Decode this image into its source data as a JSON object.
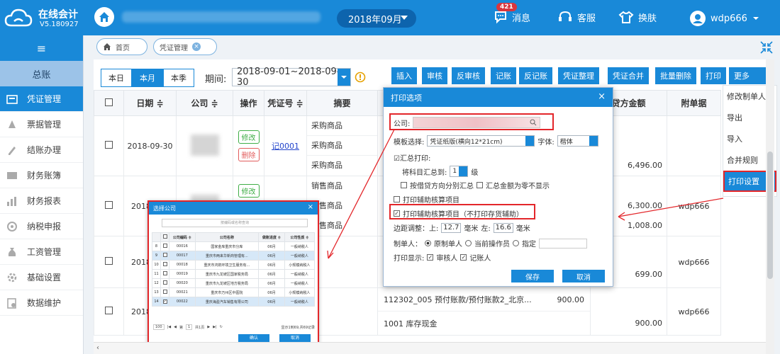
{
  "app": {
    "title": "在线会计",
    "version": "V5.180927",
    "period": "2018年09月",
    "messages": {
      "label": "消息",
      "count": "421"
    },
    "service": "客服",
    "skin": "换肤",
    "user": "wdp666"
  },
  "sidebar": {
    "collapse_icon": "≡",
    "group": "总账",
    "items": [
      {
        "label": "凭证管理",
        "icon": "voucher-icon"
      },
      {
        "label": "票据管理",
        "icon": "ticket-icon"
      },
      {
        "label": "结账办理",
        "icon": "pencil-icon"
      },
      {
        "label": "财务账簿",
        "icon": "book-icon"
      },
      {
        "label": "财务报表",
        "icon": "bar-chart-icon"
      },
      {
        "label": "纳税申报",
        "icon": "tax-icon"
      },
      {
        "label": "工资管理",
        "icon": "money-bag-icon"
      },
      {
        "label": "基础设置",
        "icon": "settings-icon"
      },
      {
        "label": "数据维护",
        "icon": "database-icon"
      }
    ]
  },
  "tabs": {
    "home": "首页",
    "voucher": "凭证管理"
  },
  "toolbar": {
    "range": [
      "本日",
      "本月",
      "本季"
    ],
    "period_label": "期间:",
    "period_value": "2018-09-01~2018-09-30",
    "actions": [
      "插入",
      "审核",
      "反审核",
      "记账",
      "反记账",
      "凭证整理",
      "凭证合并",
      "批量删除",
      "打印",
      "更多"
    ]
  },
  "table": {
    "headers": {
      "date": "日期 ≑",
      "company": "公司 ≑",
      "op": "操作",
      "voucher_no": "凭证号 ≑",
      "summary": "摘要",
      "credit": "贷方金额",
      "attach": "附单据"
    },
    "rows": [
      {
        "date": "2018-09-30",
        "voucher": "记0001",
        "edit": "修改",
        "delete": "删除",
        "summaries": [
          "采购商品",
          "采购商品",
          "采购商品"
        ],
        "credit": [
          "",
          "",
          "6,496.00"
        ],
        "attach": ""
      },
      {
        "date": "2018-",
        "edit": "修改",
        "summaries": [
          "销售商品",
          "销售商品",
          "销售商品"
        ],
        "credit": [
          "",
          "6,300.00",
          "1,008.00"
        ],
        "attach": "wdp666"
      },
      {
        "date": "2018-",
        "summaries": [],
        "credit": [
          "",
          "699.00"
        ],
        "attach": "wdp666"
      },
      {
        "date": "2018-",
        "summaries": [
          "112302_005 预付账款/预付账款2_北京...",
          "1001 库存现金"
        ],
        "debit": [
          "900.00",
          ""
        ],
        "credit": [
          "",
          "900.00"
        ],
        "attach": "wdp666"
      }
    ]
  },
  "more_menu": [
    "修改制单人",
    "导出",
    "导入",
    "合并规则",
    "打印设置"
  ],
  "print_dialog": {
    "title": "打印选项",
    "company_label": "公司:",
    "template_label": "模板选择:",
    "template_value": "凭证纸版(横向12*21cm)",
    "font_label": "字体:",
    "font_value": "楷体",
    "summary_print": "☑汇总打印:",
    "subject_summary_label": "将科目汇总到:",
    "level_value": "1",
    "level_unit": "级",
    "split_direction": "按借贷方向分别汇总",
    "zero_hide": "汇总金额为零不显示",
    "aux_item": "打印辅助核算项目",
    "aux_item_no_inventory": "打印辅助核算项目（不打印存货辅助）",
    "margin_label": "边距调整：上:",
    "margin_top": "12.7",
    "mm": "毫米",
    "margin_left_label": "左:",
    "margin_left": "16.6",
    "preparer_label": "制单人：",
    "preparer_options": [
      "原制单人",
      "当前操作员",
      "指定"
    ],
    "display_label": "打印显示:",
    "display_options": [
      "审核人",
      "记账人"
    ],
    "save": "保存",
    "cancel": "取消"
  },
  "company_popup": {
    "title": "选择公司",
    "search_placeholder": "按编码或名称查询",
    "headers": [
      "公司编码 ≑",
      "公司名称",
      "做账进度 ≑",
      "公司性质 ≑"
    ],
    "rows": [
      {
        "idx": "8",
        "code": "00016",
        "name": "国家金库重庆市分库",
        "progress": "06月",
        "type": "一般纳税人",
        "checked": false,
        "hl": false
      },
      {
        "idx": "9",
        "code": "00017",
        "name": "重庆市两来华新商管理有...",
        "progress": "06月",
        "type": "一般纳税人",
        "checked": false,
        "hl": true
      },
      {
        "idx": "10",
        "code": "00018",
        "name": "重庆市鸿鹄环境卫生服务有...",
        "progress": "06月",
        "type": "小规模纳税人",
        "checked": false,
        "hl": false
      },
      {
        "idx": "11",
        "code": "00019",
        "name": "重庆市九龙坡区国家税务局",
        "progress": "06月",
        "type": "一般纳税人",
        "checked": false,
        "hl": false
      },
      {
        "idx": "12",
        "code": "00020",
        "name": "重庆市九龙坡区地方税务局",
        "progress": "06月",
        "type": "一般纳税人",
        "checked": false,
        "hl": false
      },
      {
        "idx": "13",
        "code": "00021",
        "name": "重庆市万州区中医院",
        "progress": "06月",
        "type": "小规模纳税人",
        "checked": false,
        "hl": false
      },
      {
        "idx": "14",
        "code": "00022",
        "name": "重庆海盈汽车销售有限公司",
        "progress": "06月",
        "type": "一般纳税人",
        "checked": true,
        "hl": true
      }
    ],
    "pager": {
      "page_size": "100",
      "page_label": "第",
      "page": "1",
      "total_pages": "共1页",
      "summary": "显示1到69,共69记录"
    },
    "confirm": "确认",
    "cancel": "取消"
  }
}
